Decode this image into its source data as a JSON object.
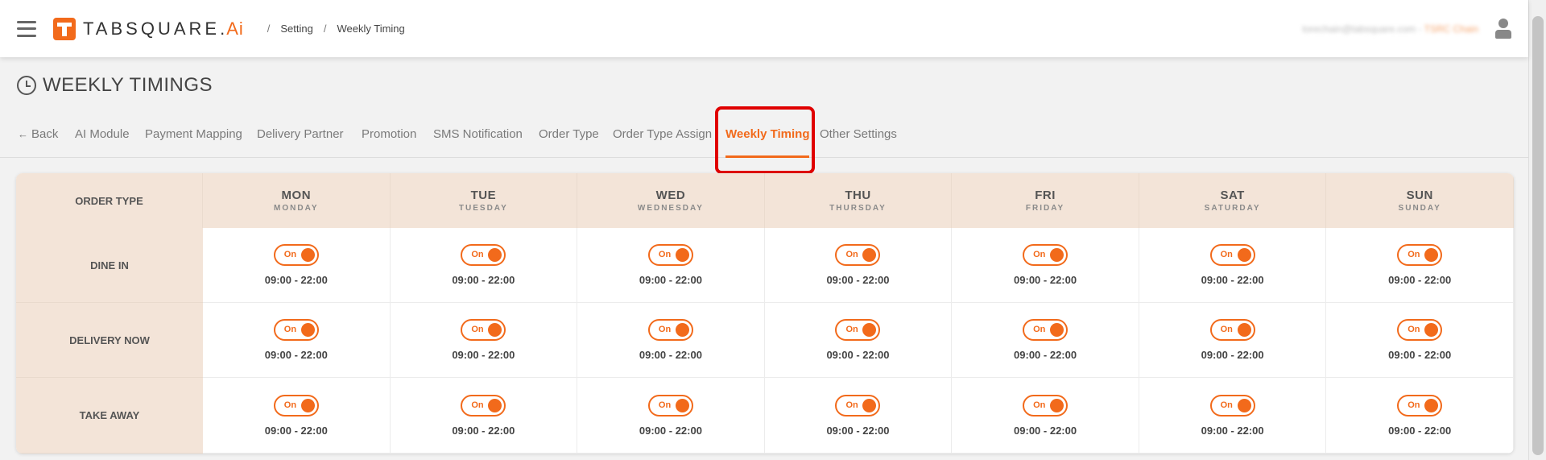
{
  "header": {
    "brand": "TABSQUARE.",
    "brand_ai": "Ai",
    "breadcrumb": [
      "Setting",
      "Weekly Timing"
    ],
    "user_email": "torechain@tabsquare.com",
    "user_separator": "-",
    "user_store": "TSRC Chain"
  },
  "page": {
    "title": "WEEKLY TIMINGS"
  },
  "tabs": [
    {
      "label": "Back"
    },
    {
      "label": "AI Module"
    },
    {
      "label": "Payment Mapping"
    },
    {
      "label": "Delivery Partner"
    },
    {
      "label": "Promotion"
    },
    {
      "label": "SMS Notification"
    },
    {
      "label": "Order Type"
    },
    {
      "label": "Order Type Assign"
    },
    {
      "label": "Weekly Timing"
    },
    {
      "label": "Other Settings"
    }
  ],
  "table": {
    "corner_label": "ORDER TYPE",
    "days": [
      {
        "short": "MON",
        "long": "MONDAY"
      },
      {
        "short": "TUE",
        "long": "TUESDAY"
      },
      {
        "short": "WED",
        "long": "WEDNESDAY"
      },
      {
        "short": "THU",
        "long": "THURSDAY"
      },
      {
        "short": "FRI",
        "long": "FRIDAY"
      },
      {
        "short": "SAT",
        "long": "SATURDAY"
      },
      {
        "short": "SUN",
        "long": "SUNDAY"
      }
    ],
    "rows": [
      {
        "name": "DINE IN",
        "cells": [
          {
            "toggle": "On",
            "time": "09:00 - 22:00"
          },
          {
            "toggle": "On",
            "time": "09:00 - 22:00"
          },
          {
            "toggle": "On",
            "time": "09:00 - 22:00"
          },
          {
            "toggle": "On",
            "time": "09:00 - 22:00"
          },
          {
            "toggle": "On",
            "time": "09:00 - 22:00"
          },
          {
            "toggle": "On",
            "time": "09:00 - 22:00"
          },
          {
            "toggle": "On",
            "time": "09:00 - 22:00"
          }
        ]
      },
      {
        "name": "DELIVERY NOW",
        "cells": [
          {
            "toggle": "On",
            "time": "09:00 - 22:00"
          },
          {
            "toggle": "On",
            "time": "09:00 - 22:00"
          },
          {
            "toggle": "On",
            "time": "09:00 - 22:00"
          },
          {
            "toggle": "On",
            "time": "09:00 - 22:00"
          },
          {
            "toggle": "On",
            "time": "09:00 - 22:00"
          },
          {
            "toggle": "On",
            "time": "09:00 - 22:00"
          },
          {
            "toggle": "On",
            "time": "09:00 - 22:00"
          }
        ]
      },
      {
        "name": "TAKE AWAY",
        "cells": [
          {
            "toggle": "On",
            "time": "09:00 - 22:00"
          },
          {
            "toggle": "On",
            "time": "09:00 - 22:00"
          },
          {
            "toggle": "On",
            "time": "09:00 - 22:00"
          },
          {
            "toggle": "On",
            "time": "09:00 - 22:00"
          },
          {
            "toggle": "On",
            "time": "09:00 - 22:00"
          },
          {
            "toggle": "On",
            "time": "09:00 - 22:00"
          },
          {
            "toggle": "On",
            "time": "09:00 - 22:00"
          }
        ]
      }
    ]
  }
}
